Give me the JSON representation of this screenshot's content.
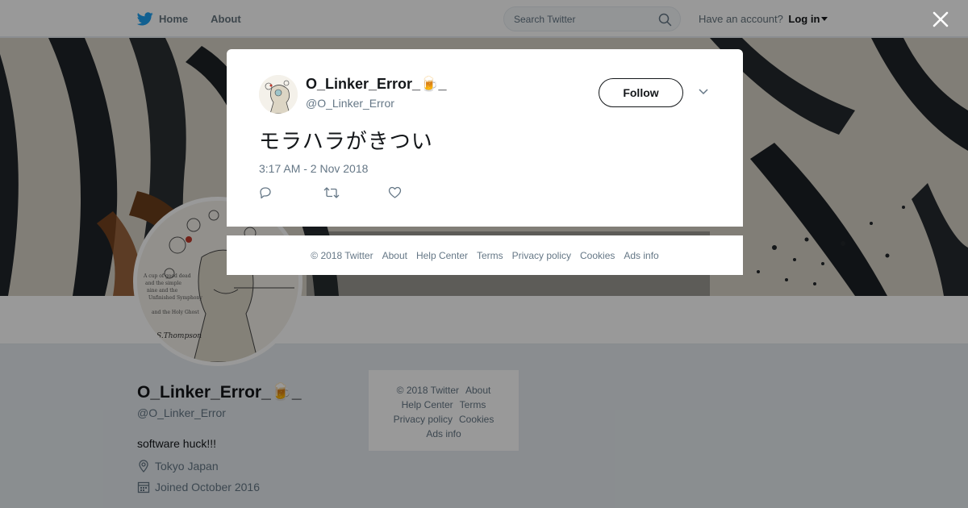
{
  "nav": {
    "home_label": "Home",
    "about_label": "About",
    "search_placeholder": "Search Twitter",
    "account_prompt": "Have an account?",
    "login_label": "Log in"
  },
  "colors": {
    "brand": "#1da1f2",
    "text": "#14171a",
    "muted": "#657786"
  },
  "profile": {
    "name": "O_Linker_Error_🍺_",
    "handle": "@O_Linker_Error",
    "bio": "software huck!!!",
    "location": "Tokyo Japan",
    "joined": "Joined October 2016",
    "avatar_signature": "S.Thompson"
  },
  "side_footer": {
    "copyright": "© 2018 Twitter",
    "about": "About",
    "help_center": "Help Center",
    "terms": "Terms",
    "privacy": "Privacy policy",
    "cookies": "Cookies",
    "ads_info": "Ads info"
  },
  "tweet": {
    "author_name": "O_Linker_Error_🍺_",
    "author_handle": "@O_Linker_Error",
    "follow_label": "Follow",
    "text": "モラハラがきつい",
    "timestamp": "3:17 AM - 2 Nov 2018",
    "icons": {
      "reply": "reply-icon",
      "retweet": "retweet-icon",
      "like": "heart-icon",
      "more": "chevron-down-icon"
    }
  },
  "modal_footer": {
    "copyright": "© 2018 Twitter",
    "about": "About",
    "help_center": "Help Center",
    "terms": "Terms",
    "privacy": "Privacy policy",
    "cookies": "Cookies",
    "ads_info": "Ads info"
  }
}
